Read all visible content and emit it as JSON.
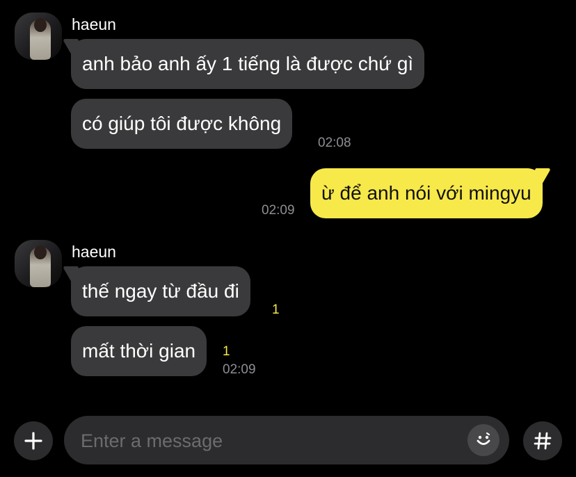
{
  "chat": {
    "groups": [
      {
        "sender": "haeun",
        "messages": [
          {
            "text": "anh bảo anh ấy 1 tiếng là được chứ gì"
          },
          {
            "text": "có giúp tôi được không",
            "time": "02:08"
          }
        ]
      },
      {
        "outgoing": true,
        "messages": [
          {
            "text": "ừ để anh nói với mingyu",
            "time": "02:09"
          }
        ]
      },
      {
        "sender": "haeun",
        "messages": [
          {
            "text": "thế ngay từ đầu đi",
            "unread": "1"
          },
          {
            "text": "mất thời gian",
            "unread": "1",
            "time": "02:09"
          }
        ]
      }
    ]
  },
  "composer": {
    "placeholder": "Enter a message",
    "add_icon": "plus-icon",
    "emoji_icon": "smiley-icon",
    "hashtag_icon": "hash-icon"
  },
  "colors": {
    "background": "#000000",
    "incoming_bubble": "#3a3a3c",
    "outgoing_bubble": "#f7e94a",
    "unread": "#f7e94a",
    "timestamp": "#8e8e93"
  }
}
